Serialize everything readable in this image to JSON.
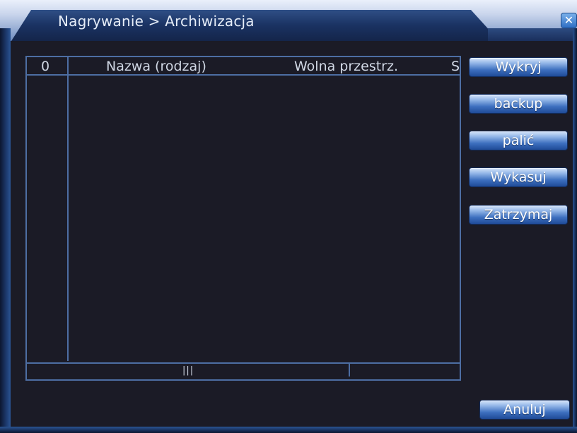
{
  "window": {
    "title": "Nagrywanie > Archiwizacja",
    "close_icon": "close-icon"
  },
  "list": {
    "headers": {
      "index": "0",
      "name": "Nazwa (rodzaj)",
      "free_space": "Wolna przestrz.",
      "extra": "S"
    },
    "rows": [],
    "scrollbar_grip": "|||"
  },
  "buttons": {
    "detect": "Wykryj",
    "backup": "backup",
    "burn": "palić",
    "erase": "Wykasuj",
    "stop": "Zatrzymaj",
    "cancel": "Anuluj"
  },
  "colors": {
    "background": "#1b1b26",
    "border": "#4d6ea3",
    "button": "#3d6fbf",
    "title_bar": "#1a3262"
  }
}
